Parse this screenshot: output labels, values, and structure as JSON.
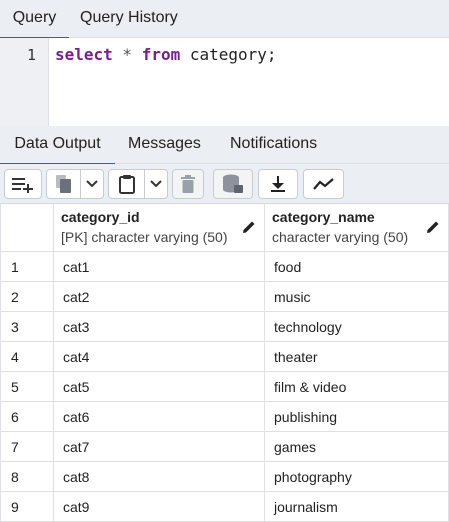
{
  "query_tabs": [
    {
      "label": "Query",
      "active": true
    },
    {
      "label": "Query History",
      "active": false
    }
  ],
  "editor": {
    "line_number": "1",
    "tokens": {
      "kw_select": "select",
      "star": " * ",
      "kw_from": "from",
      "rest": " category;"
    }
  },
  "result_tabs": [
    {
      "label": "Data Output",
      "active": true
    },
    {
      "label": "Messages",
      "active": false
    },
    {
      "label": "Notifications",
      "active": false
    }
  ],
  "toolbar": {
    "icons": [
      "add-row-icon",
      "copy-icon",
      "copy-dropdown-icon",
      "paste-icon",
      "paste-dropdown-icon",
      "delete-icon",
      "save-data-icon",
      "download-icon",
      "graph-icon"
    ]
  },
  "columns": [
    {
      "name": "category_id",
      "type": "[PK] character varying (50)"
    },
    {
      "name": "category_name",
      "type": "character varying (50)"
    }
  ],
  "rows": [
    {
      "n": "1",
      "id": "cat1",
      "name": "food"
    },
    {
      "n": "2",
      "id": "cat2",
      "name": "music"
    },
    {
      "n": "3",
      "id": "cat3",
      "name": "technology"
    },
    {
      "n": "4",
      "id": "cat4",
      "name": "theater"
    },
    {
      "n": "5",
      "id": "cat5",
      "name": "film & video"
    },
    {
      "n": "6",
      "id": "cat6",
      "name": "publishing"
    },
    {
      "n": "7",
      "id": "cat7",
      "name": "games"
    },
    {
      "n": "8",
      "id": "cat8",
      "name": "photography"
    },
    {
      "n": "9",
      "id": "cat9",
      "name": "journalism"
    }
  ],
  "colors": {
    "accent": "#326690",
    "keyword": "#7a1e8f",
    "panel": "#ebeef3"
  }
}
